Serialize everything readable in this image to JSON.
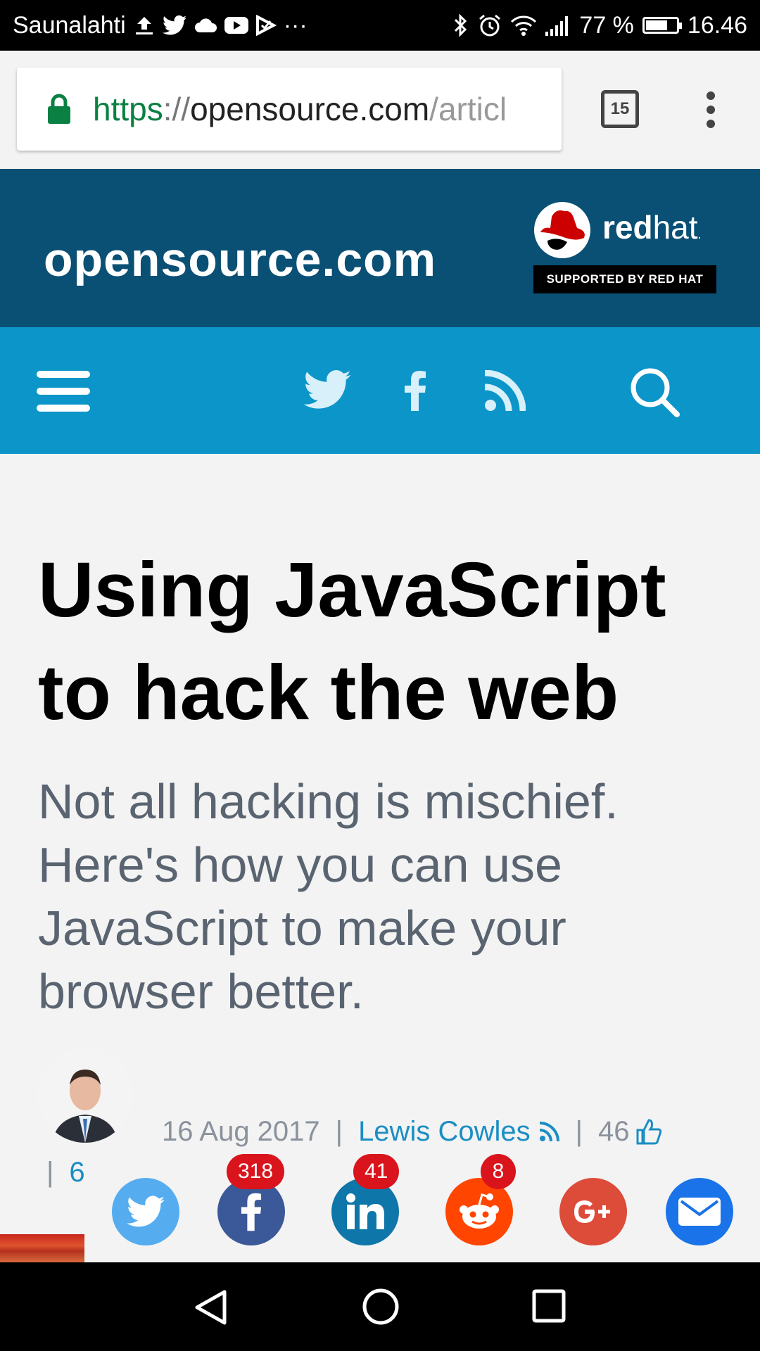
{
  "status_bar": {
    "carrier": "Saunalahti",
    "more": "···",
    "battery_percent": "77 %",
    "battery_level": 0.77,
    "time": "16.46",
    "icons": [
      "upload-icon",
      "twitter-icon",
      "cloud-icon",
      "youtube-icon",
      "tasks-icon",
      "bluetooth-icon",
      "alarm-icon",
      "wifi-icon",
      "signal-icon",
      "battery-icon"
    ]
  },
  "browser": {
    "url_scheme": "https",
    "url_sep": "://",
    "url_host": "opensource.com",
    "url_path": "/articl",
    "tab_count": "15"
  },
  "site": {
    "name": "opensource.com",
    "redhat_red": "red",
    "redhat_hat": "hat",
    "redhat_tm": ".",
    "supported_by": "SUPPORTED BY RED HAT",
    "header_color": "#0a4f74",
    "nav_color": "#0c95c9"
  },
  "article": {
    "title_line1": "Using JavaScript",
    "title_line2": "to hack the web",
    "subtitle_line1": "Not all hacking is mischief.",
    "subtitle_line2": "Here's how you can use",
    "subtitle_line3": "JavaScript to make your",
    "subtitle_line4": "browser better.",
    "date": "16 Aug 2017",
    "author": "Lewis Cowles",
    "likes": "46",
    "comments": "6"
  },
  "share": {
    "facebook_count": "318",
    "linkedin_count": "41",
    "reddit_count": "8",
    "colors": {
      "twitter": "#55acee",
      "facebook": "#3b5998",
      "linkedin": "#0e76a8",
      "reddit": "#ff4500",
      "google": "#dd4b39",
      "email": "#1a73e8"
    }
  }
}
